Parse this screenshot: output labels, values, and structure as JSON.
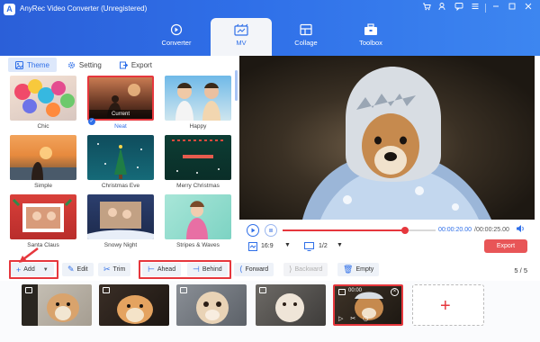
{
  "window": {
    "title": "AnyRec Video Converter (Unregistered)",
    "controls": [
      "cart-icon",
      "user-key-icon",
      "chat-icon",
      "menu-icon",
      "minimize-icon",
      "maximize-icon",
      "close-icon"
    ]
  },
  "tabs": [
    {
      "label": "Converter",
      "icon": "converter-icon",
      "active": false
    },
    {
      "label": "MV",
      "icon": "mv-icon",
      "active": true
    },
    {
      "label": "Collage",
      "icon": "collage-icon",
      "active": false
    },
    {
      "label": "Toolbox",
      "icon": "toolbox-icon",
      "active": false
    }
  ],
  "subtabs": [
    {
      "label": "Theme",
      "icon": "theme-icon",
      "active": true
    },
    {
      "label": "Setting",
      "icon": "gear-icon",
      "active": false
    },
    {
      "label": "Export",
      "icon": "export-icon",
      "active": false
    }
  ],
  "themes": [
    {
      "name": "Chic",
      "selected": false
    },
    {
      "name": "Neat",
      "selected": true,
      "badge": "Current"
    },
    {
      "name": "Happy",
      "selected": false
    },
    {
      "name": "Simple",
      "selected": false
    },
    {
      "name": "Christmas Eve",
      "selected": false
    },
    {
      "name": "Merry Christmas",
      "selected": false
    },
    {
      "name": "Santa Claus",
      "selected": false
    },
    {
      "name": "Snowy Night",
      "selected": false
    },
    {
      "name": "Stripes & Waves",
      "selected": false
    }
  ],
  "player": {
    "current_time": "00:00:20.00",
    "total_time": "/00:00:25.00",
    "progress": 0.8,
    "aspect_ratio": "16:9",
    "page": "1/2",
    "export_label": "Export"
  },
  "toolbar": {
    "add": "Add",
    "edit": "Edit",
    "trim": "Trim",
    "ahead": "Ahead",
    "behind": "Behind",
    "forward": "Forward",
    "backward": "Backward",
    "empty": "Empty",
    "counter": "5 / 5"
  },
  "clips": [
    {
      "active": false
    },
    {
      "active": false
    },
    {
      "active": false
    },
    {
      "active": false
    },
    {
      "active": true,
      "time": "00:00"
    }
  ],
  "colors": {
    "accent": "#2f6fe8",
    "highlight": "#e6373d",
    "export": "#e85557"
  }
}
